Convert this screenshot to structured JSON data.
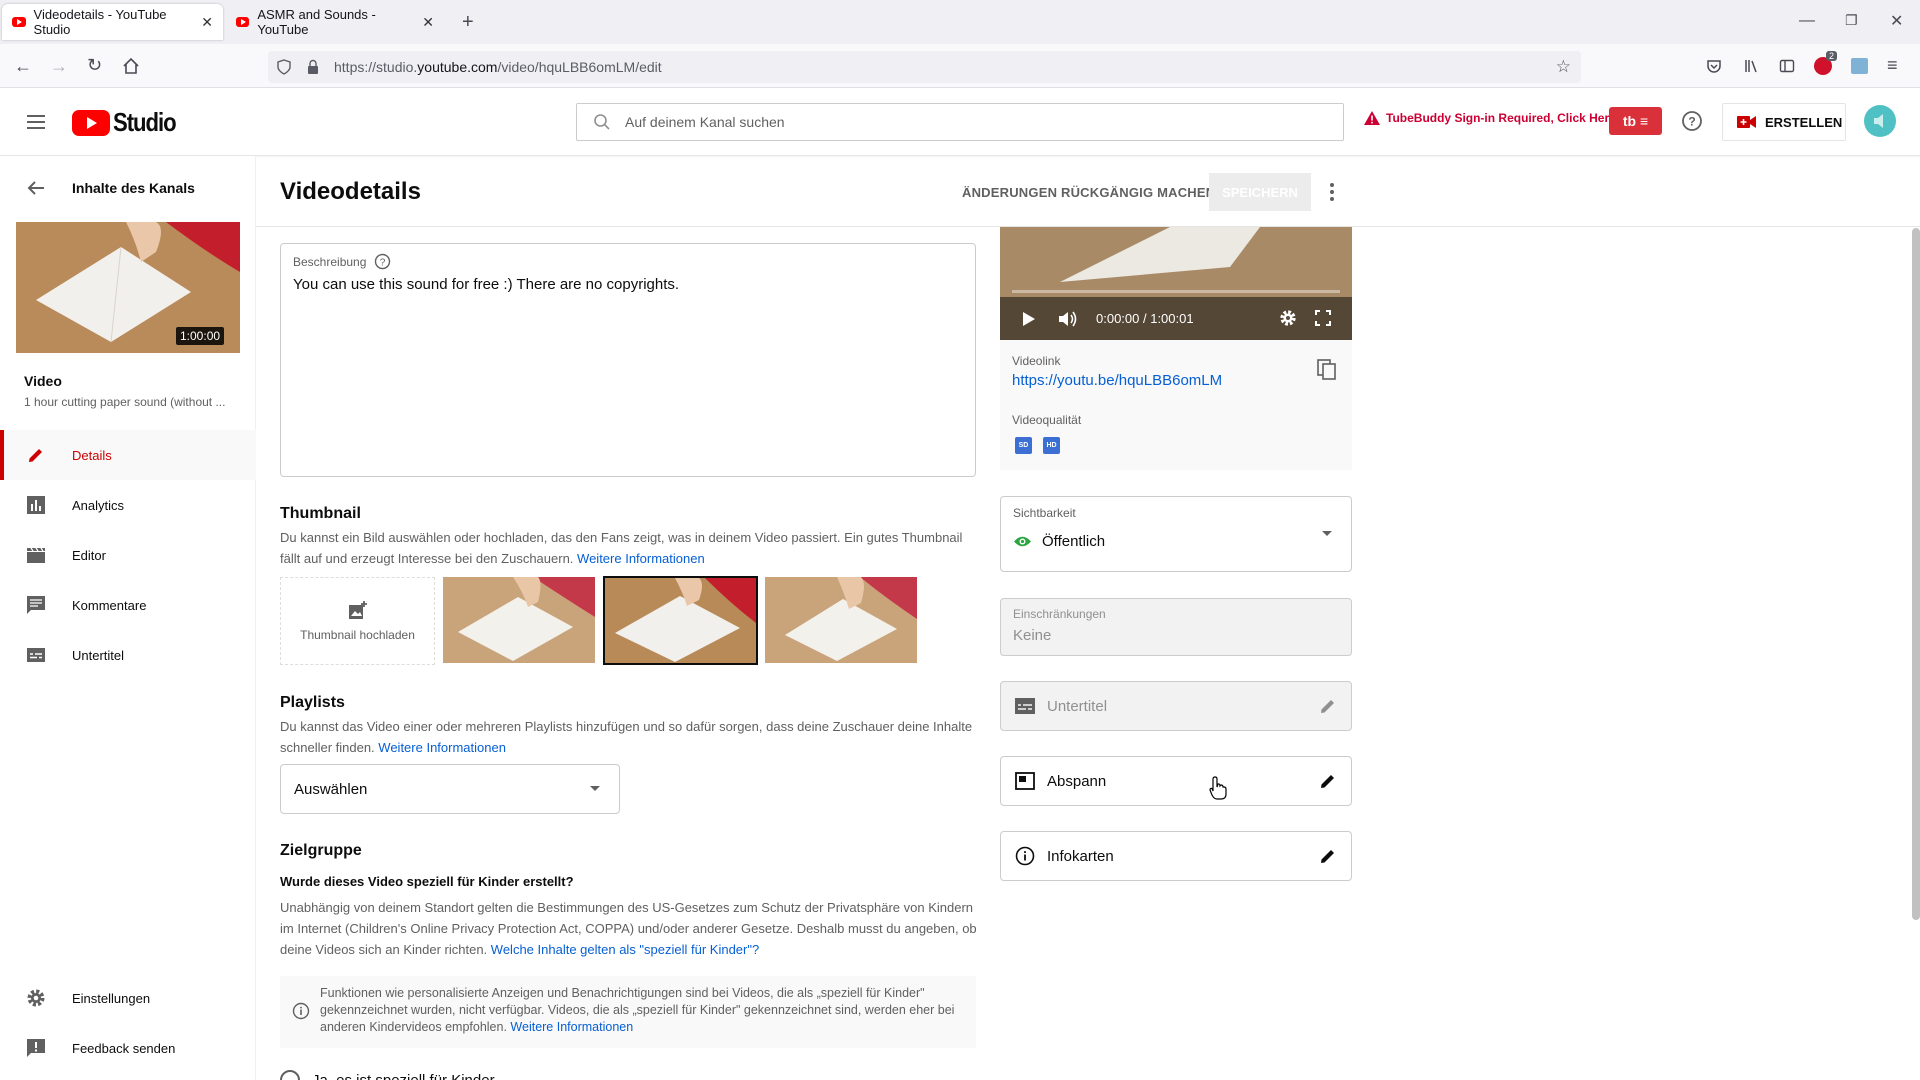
{
  "browser": {
    "tabs": [
      {
        "title": "Videodetails - YouTube Studio",
        "active": true
      },
      {
        "title": "ASMR and Sounds - YouTube",
        "active": false
      }
    ],
    "url_prefix": "https://studio.",
    "url_domain": "youtube.com",
    "url_path": "/video/hquLBB6omLM/edit",
    "ext_badge": "2"
  },
  "header": {
    "logo_text": "Studio",
    "search_placeholder": "Auf deinem Kanal suchen",
    "tubebuddy_warning": "TubeBuddy Sign-in Required, Click Here",
    "create_label": "ERSTELLEN"
  },
  "sidebar": {
    "back_label": "Inhalte des Kanals",
    "video_duration": "1:00:00",
    "video_heading": "Video",
    "video_title": "1 hour cutting paper sound (without ...",
    "items": [
      {
        "label": "Details",
        "icon": "pencil-icon",
        "active": true
      },
      {
        "label": "Analytics",
        "icon": "analytics-icon",
        "active": false
      },
      {
        "label": "Editor",
        "icon": "clapperboard-icon",
        "active": false
      },
      {
        "label": "Kommentare",
        "icon": "comment-icon",
        "active": false
      },
      {
        "label": "Untertitel",
        "icon": "subtitles-icon",
        "active": false
      }
    ],
    "settings_label": "Einstellungen",
    "feedback_label": "Feedback senden"
  },
  "main": {
    "page_title": "Videodetails",
    "undo_label": "ÄNDERUNGEN RÜCKGÄNGIG MACHEN",
    "save_label": "SPEICHERN",
    "description": {
      "label": "Beschreibung",
      "value": "You can use this sound for free :) There are no copyrights."
    },
    "thumbnail": {
      "title": "Thumbnail",
      "text": "Du kannst ein Bild auswählen oder hochladen, das den Fans zeigt, was in deinem Video passiert. Ein gutes Thumbnail fällt auf und erzeugt Interesse bei den Zuschauern.",
      "link": "Weitere Informationen",
      "upload_label": "Thumbnail hochladen"
    },
    "playlists": {
      "title": "Playlists",
      "text": "Du kannst das Video einer oder mehreren Playlists hinzufügen und so dafür sorgen, dass deine Zuschauer deine Inhalte schneller finden.",
      "link": "Weitere Informationen",
      "select_value": "Auswählen"
    },
    "audience": {
      "title": "Zielgruppe",
      "question": "Wurde dieses Video speziell für Kinder erstellt?",
      "text": "Unabhängig von deinem Standort gelten die Bestimmungen des US-Gesetzes zum Schutz der Privatsphäre von Kindern im Internet (Children's Online Privacy Protection Act, COPPA) und/oder anderer Gesetze. Deshalb musst du angeben, ob deine Videos sich an Kinder richten.",
      "link": "Welche Inhalte gelten als \"speziell für Kinder\"?",
      "info_text": "Funktionen wie personalisierte Anzeigen und Benachrichtigungen sind bei Videos, die als „speziell für Kinder\" gekennzeichnet wurden, nicht verfügbar. Videos, die als „speziell für Kinder\" gekennzeichnet sind, werden eher bei anderen Kindervideos empfohlen.",
      "info_link": "Weitere Informationen",
      "radio_yes": "Ja, es ist speziell für Kinder"
    }
  },
  "right": {
    "player_time": "0:00:00 / 1:00:01",
    "videolink_label": "Videolink",
    "videolink": "https://youtu.be/hquLBB6omLM",
    "quality_label": "Videoqualität",
    "quality_badges": [
      "SD",
      "HD"
    ],
    "visibility_label": "Sichtbarkeit",
    "visibility_value": "Öffentlich",
    "restrictions_label": "Einschränkungen",
    "restrictions_value": "Keine",
    "subtitles_label": "Untertitel",
    "endscreen_label": "Abspann",
    "cards_label": "Infokarten"
  },
  "colors": {
    "accent_red": "#cc0000",
    "link_blue": "#065fd4",
    "tubebuddy_red": "#cc0033",
    "public_green": "#2ba640"
  }
}
